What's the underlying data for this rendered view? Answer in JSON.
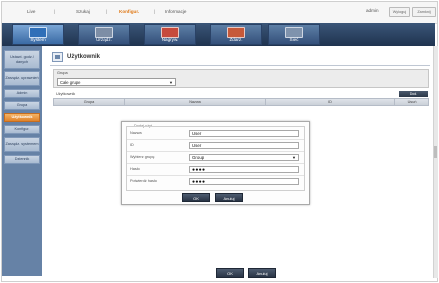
{
  "topbar": {
    "items": [
      "Live",
      "Szukaj",
      "Konfigur.",
      "Informacje"
    ],
    "active_index": 2,
    "user": "admin",
    "buttons": [
      "Wyloguj",
      "Zamknij"
    ]
  },
  "navbar": {
    "tabs": [
      {
        "label": "System",
        "icon": "system-icon",
        "color": "#2f6fb8"
      },
      {
        "label": "Urządz.",
        "icon": "device-icon",
        "color": "#7d8ea6"
      },
      {
        "label": "Nagryw.",
        "icon": "record-icon",
        "color": "#c64a3c"
      },
      {
        "label": "Zdarz.",
        "icon": "event-icon",
        "color": "#c6593a"
      },
      {
        "label": "Sieć",
        "icon": "network-icon",
        "color": "#7f93ad"
      }
    ],
    "active_index": 0
  },
  "sidebar": {
    "items": [
      {
        "label": "Ustawi. godz./ danych"
      },
      {
        "label": "Zarządz. uprawnień"
      },
      {
        "label": "Admin"
      },
      {
        "label": "Grupa"
      },
      {
        "label": "Użytkownik"
      },
      {
        "label": "Konfigur."
      },
      {
        "label": "Zarządz. systemem"
      },
      {
        "label": "Dziennik"
      }
    ],
    "active_index": 4
  },
  "page": {
    "title": "Użytkownik",
    "group_label": "Grupa",
    "group_value": "Całe grupe",
    "users_label": "Użytkownik",
    "add_button": "Dod.",
    "columns": [
      "Grupa",
      "Nazwa",
      "ID",
      "Usuń"
    ]
  },
  "modal": {
    "title": "Dodaj użyt.",
    "fields": [
      {
        "label": "Nazwa",
        "value": "User"
      },
      {
        "label": "ID",
        "value": "User"
      },
      {
        "label": "Wybierz grupę",
        "value": "Group"
      },
      {
        "label": "Hasło",
        "value": "●●●●"
      },
      {
        "label": "Potwierdź hasło",
        "value": "●●●●"
      }
    ],
    "ok": "OK",
    "cancel": "Anuluj"
  },
  "footer": {
    "ok": "OK",
    "cancel": "Anuluj"
  }
}
